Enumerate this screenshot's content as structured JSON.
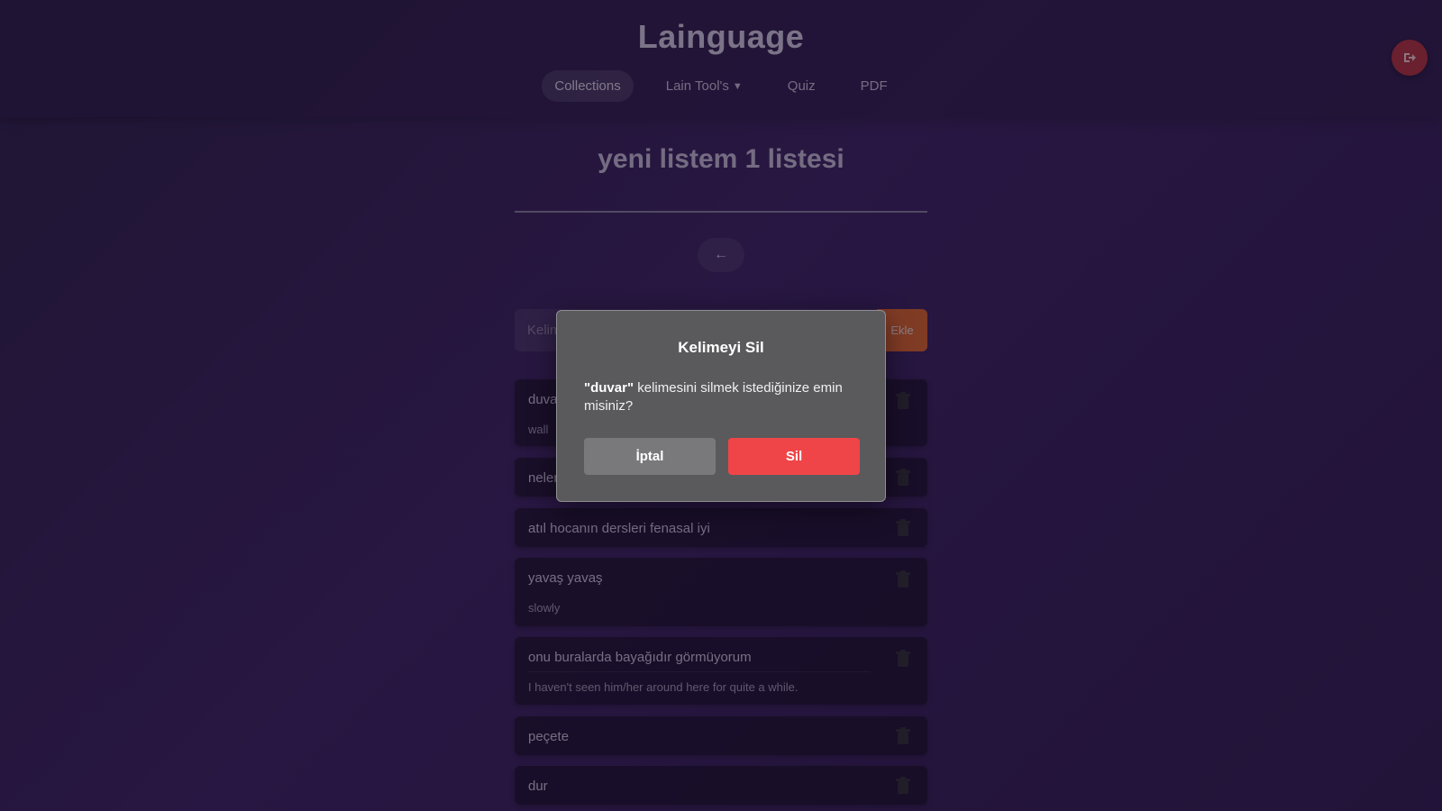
{
  "app": {
    "brand": "Lainguage"
  },
  "nav": {
    "collections": "Collections",
    "tools": "Lain Tool's",
    "quiz": "Quiz",
    "pdf": "PDF"
  },
  "list": {
    "title": "yeni listem 1 listesi",
    "back_icon": "arrow-left-icon",
    "input_placeholder": "Kelime",
    "add_label": "Ekle"
  },
  "words": [
    {
      "word": "duvar",
      "meaning": "wall"
    },
    {
      "word": "neler",
      "meaning": ""
    },
    {
      "word": "atıl hocanın dersleri fenasal iyi",
      "meaning": ""
    },
    {
      "word": "yavaş yavaş",
      "meaning": "slowly"
    },
    {
      "word": "onu buralarda bayağıdır görmüyorum",
      "meaning": "I haven't seen him/her around here for quite a while."
    },
    {
      "word": "peçete",
      "meaning": ""
    },
    {
      "word": "dur",
      "meaning": ""
    }
  ],
  "modal": {
    "title": "Kelimeyi Sil",
    "quoted_word": "\"duvar\"",
    "message": " kelimesini silmek istediğinize emin misiniz?",
    "cancel_label": "İptal",
    "delete_label": "Sil"
  },
  "colors": {
    "accent_orange": "#e3662a",
    "danger_red": "#f04548",
    "logout_red": "#b8323a"
  }
}
